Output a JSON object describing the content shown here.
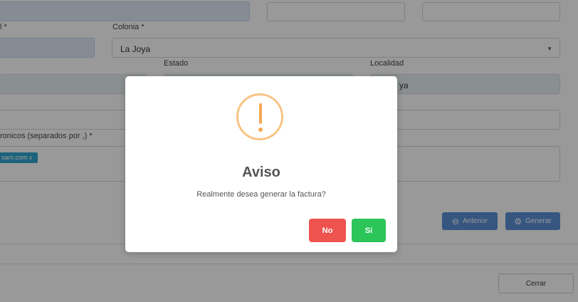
{
  "form": {
    "label_postal_partial": "l *",
    "label_colonia": "Colonia *",
    "colonia_value": "La Joya",
    "label_estado": "Estado",
    "label_localidad": "Localidad",
    "localidad_value_partial": "ya",
    "label_emails_partial": "ronicos (separados por ,) *",
    "email_tag_partial": "sam.com",
    "email_tag_remove": "x",
    "anterior_label": "Anterior",
    "generar_label": "Generar",
    "cerrar_label": "Cerrar"
  },
  "dialog": {
    "title": "Aviso",
    "message": "Realmente desea generar la factura?",
    "no_label": "No",
    "si_label": "Si",
    "colors": {
      "no": "#ef5350",
      "si": "#2bc55a",
      "icon": "#f3a953"
    }
  },
  "icons": {
    "warning": "exclamation-circle-icon",
    "anterior": "arrow-left-circle-icon",
    "generar": "gear-icon",
    "dropdown": "caret-down-icon"
  }
}
